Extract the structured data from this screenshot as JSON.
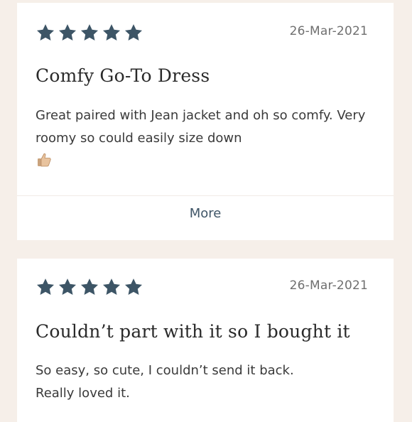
{
  "colors": {
    "star": "#3d5566",
    "page_bg": "#f6efe9",
    "card_bg": "#ffffff",
    "more_link": "#3f5567"
  },
  "reviews": [
    {
      "rating": 5,
      "date": "26-Mar-2021",
      "title": "Comfy Go-To Dress",
      "body": "Great paired with Jean jacket and oh so comfy. Very roomy so could easily size down",
      "emoji": "thumbs-up-icon",
      "more_label": "More"
    },
    {
      "rating": 5,
      "date": "26-Mar-2021",
      "title": "Couldn’t part with it so I bought it",
      "body_line1": "So easy, so cute, I couldn’t send it back.",
      "body_line2": "Really loved it."
    }
  ]
}
